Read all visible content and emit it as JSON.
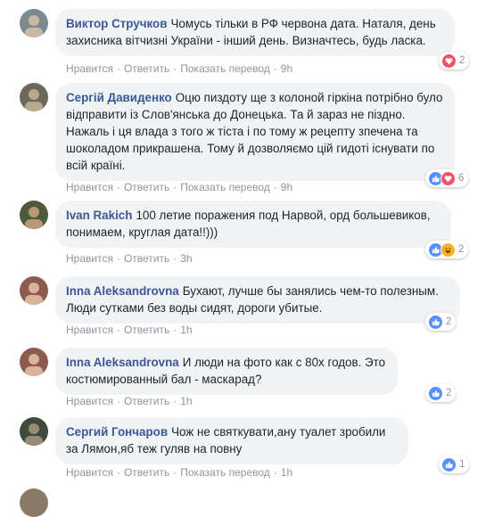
{
  "actions": {
    "like": "Нравится",
    "reply": "Ответить",
    "translate": "Показать перевод",
    "separator": "·"
  },
  "comments": [
    {
      "author": "Виктор Стручков",
      "text": "Чомусь тільки в РФ червона дата. Наталя, день захисника вітчизні України - інший день. Визначтесь, будь ласка.",
      "time": "9h",
      "show_translate": true,
      "reactions": [
        "love"
      ],
      "reaction_count": "2"
    },
    {
      "author": "Сергій Давиденко",
      "text": "Оцю пиздоту ще з колоной гіркіна потрібно було відправити із Слов'янська до Донецька. Та й зараз не піздно. Нажаль і ця влада з того ж тіста і по тому ж рецепту зпечена та шоколадом прикрашена. Тому й дозволяємо цій гидоті існувати по всій країні.",
      "time": "9h",
      "show_translate": true,
      "reactions": [
        "like",
        "love"
      ],
      "reaction_count": "6"
    },
    {
      "author": "Ivan Rakich",
      "text": "100 летие поражения под Нарвой, орд большевиков, понимаем, круглая дата!!)))",
      "time": "3h",
      "show_translate": false,
      "reactions": [
        "like",
        "haha"
      ],
      "reaction_count": "2"
    },
    {
      "author": "Inna Aleksandrovna",
      "text": "Бухают, лучше бы занялись чем-то полезным. Люди сутками без воды сидят, дороги убитые.",
      "time": "1h",
      "show_translate": false,
      "reactions": [
        "like"
      ],
      "reaction_count": "2"
    },
    {
      "author": "Inna Aleksandrovna",
      "text": "И люди на фото как с 80х годов. Это костюмированный бал - маскарад?",
      "time": "1h",
      "show_translate": false,
      "reactions": [
        "like"
      ],
      "reaction_count": "2"
    },
    {
      "author": "Сергий Гончаров",
      "text": "Чож не святкувати,ану туалет зробили за Лямон,яб теж гуляв на повну",
      "time": "1h",
      "show_translate": true,
      "reactions": [
        "like"
      ],
      "reaction_count": "1"
    }
  ],
  "colors": {
    "author": "#385898",
    "bubble": "#f2f3f5",
    "meta": "#90949c",
    "like": "#5890ff",
    "love": "#f25268",
    "haha": "#f7b125"
  }
}
